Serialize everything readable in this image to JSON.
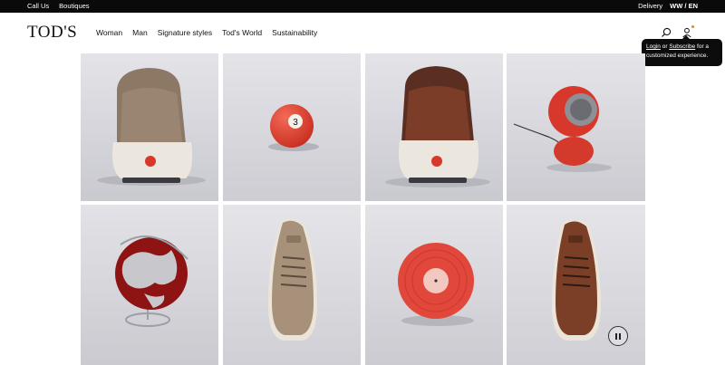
{
  "topbar": {
    "call_us": "Call Us",
    "boutiques": "Boutiques",
    "delivery": "Delivery",
    "language": "WW / EN"
  },
  "header": {
    "logo": "TOD'S",
    "nav": [
      "Woman",
      "Man",
      "Signature styles",
      "Tod's World",
      "Sustainability"
    ],
    "icons": [
      "search-icon",
      "user-icon"
    ]
  },
  "tooltip": {
    "login": "Login",
    "or": " or ",
    "subscribe": "Subscribe",
    "rest": " for a customized experience."
  },
  "gallery": {
    "tiles": [
      "suede-sneaker-back",
      "red-billiard-ball",
      "leather-sneaker-back",
      "red-desk-lamp",
      "red-globe",
      "suede-sneaker-top",
      "red-vinyl-record",
      "leather-sneaker-top"
    ],
    "billiard_number": "3"
  },
  "colors": {
    "accent_red": "#d8372b",
    "background": "#d9d9de",
    "topbar": "#0a0a0a"
  }
}
